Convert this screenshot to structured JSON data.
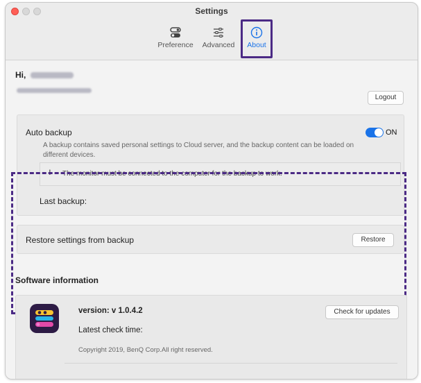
{
  "window": {
    "title": "Settings"
  },
  "tabs": [
    {
      "label": "Preference",
      "icon": "toggle-switch-icon"
    },
    {
      "label": "Advanced",
      "icon": "sliders-icon"
    },
    {
      "label": "About",
      "icon": "info-circle-icon",
      "active": true
    }
  ],
  "account": {
    "greeting": "Hi,",
    "logout_label": "Logout"
  },
  "auto_backup": {
    "title": "Auto backup",
    "toggle_label": "ON",
    "toggle_on": true,
    "description": "A backup contains saved personal settings to Cloud server, and the backup content can be loaded on different devices.",
    "note_symbol": "!",
    "note": "The monitor must be connected to the computer for the backup to work.",
    "last_backup_label": "Last backup:"
  },
  "restore": {
    "title": "Restore settings from backup",
    "button_label": "Restore"
  },
  "software": {
    "heading": "Software information",
    "version": "version: v 1.0.4.2",
    "check_button": "Check for updates",
    "latest_check": "Latest check time:",
    "copyright": "Copyright  2019, BenQ Corp.All right reserved."
  },
  "colors": {
    "accent": "#1a73e8",
    "highlight_border": "#4b2a85",
    "close_button": "#ff5f57"
  }
}
